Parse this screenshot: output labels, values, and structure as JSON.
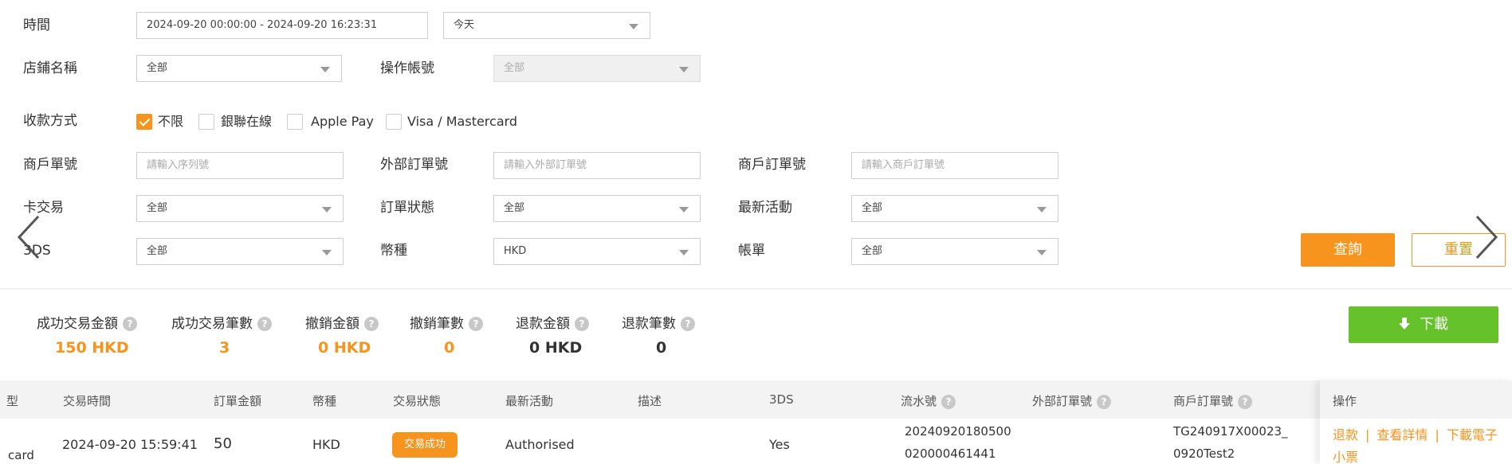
{
  "filters": {
    "time_label": "時間",
    "time_range_value": "2024-09-20 00:00:00 - 2024-09-20 16:23:31",
    "time_preset_value": "今天",
    "store_label": "店鋪名稱",
    "store_value": "全部",
    "operator_label": "操作帳號",
    "operator_value": "全部",
    "payment_label": "收款方式",
    "payment_options": [
      {
        "label": "不限",
        "checked": true
      },
      {
        "label": "銀聯在線",
        "checked": false
      },
      {
        "label": "Apple Pay",
        "checked": false
      },
      {
        "label": "Visa / Mastercard",
        "checked": false
      }
    ],
    "merchant_no_label": "商戶單號",
    "merchant_no_placeholder": "請輸入序列號",
    "external_order_label": "外部訂單號",
    "external_order_placeholder": "請輸入外部訂單號",
    "merchant_order_label": "商戶訂單號",
    "merchant_order_placeholder": "請輸入商戶訂單號",
    "card_tx_label": "卡交易",
    "card_tx_value": "全部",
    "order_status_label": "訂單狀態",
    "order_status_value": "全部",
    "latest_activity_label": "最新活動",
    "latest_activity_value": "全部",
    "threeds_label": "3DS",
    "threeds_value": "全部",
    "currency_label": "幣種",
    "currency_value": "HKD",
    "bill_label": "帳單",
    "bill_value": "全部",
    "query_button": "查詢",
    "reset_button": "重置"
  },
  "stats": [
    {
      "label": "成功交易金額",
      "value": "150 HKD",
      "color": "#f7941d"
    },
    {
      "label": "成功交易筆數",
      "value": "3",
      "color": "#f7941d"
    },
    {
      "label": "撤銷金額",
      "value": "0 HKD",
      "color": "#f7941d"
    },
    {
      "label": "撤銷筆數",
      "value": "0",
      "color": "#f7941d"
    },
    {
      "label": "退款金額",
      "value": "0 HKD",
      "color": "#333333"
    },
    {
      "label": "退款筆數",
      "value": "0",
      "color": "#333333"
    }
  ],
  "download_button": "下載",
  "table": {
    "columns": [
      "交易時間",
      "訂單金額",
      "幣種",
      "交易狀態",
      "最新活動",
      "描述",
      "3DS",
      "流水號",
      "外部訂單號",
      "商戶訂單號",
      "操作"
    ],
    "first_col_fragment": "型",
    "rows": [
      {
        "card_fragment": "card",
        "time": "2024-09-20 15:59:41",
        "amount": "50",
        "currency": "HKD",
        "status": "交易成功",
        "latest_activity": "Authorised",
        "description": "",
        "threeds": "Yes",
        "serial_line1": "20240920180500",
        "serial_line2": "020000461441",
        "external_order": "",
        "merchant_order_line1": "TG240917X00023_",
        "merchant_order_line2": "0920Test2",
        "actions": [
          "退款",
          "查看詳情",
          "下載電子小票"
        ]
      }
    ]
  },
  "colors": {
    "accent": "#f7941d",
    "download_green": "#65c22b"
  }
}
